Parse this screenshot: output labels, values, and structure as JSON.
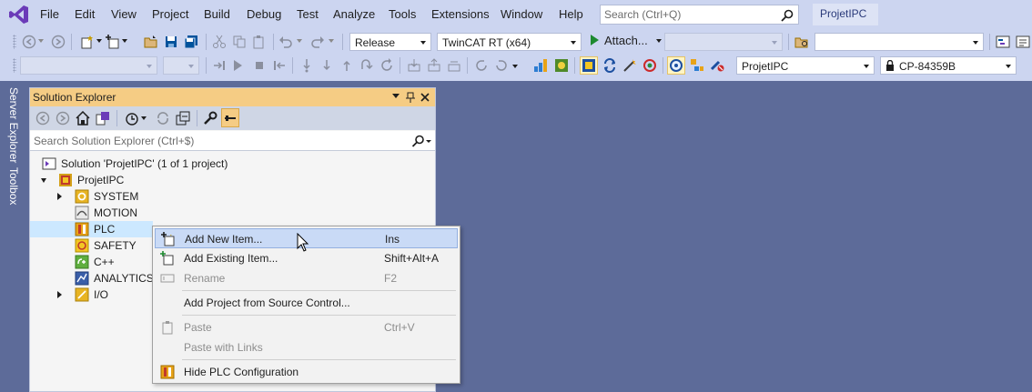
{
  "menu": [
    "File",
    "Edit",
    "View",
    "Project",
    "Build",
    "Debug",
    "Test",
    "Analyze",
    "Tools",
    "Extensions",
    "Window",
    "Help"
  ],
  "search": {
    "placeholder": "Search (Ctrl+Q)"
  },
  "project_title": "ProjetIPC",
  "toolbar1": {
    "configuration": "Release",
    "platform": "TwinCAT RT (x64)",
    "attach": "Attach...",
    "empty_combo_1": "",
    "empty_combo_2": ""
  },
  "toolbar2": {
    "project_combo": "ProjetIPC",
    "target_combo": "CP-84359B"
  },
  "side_tabs": [
    "Server Explorer",
    "Toolbox"
  ],
  "solution_explorer": {
    "title": "Solution Explorer",
    "search_placeholder": "Search Solution Explorer (Ctrl+$)",
    "solution_label": "Solution 'ProjetIPC' (1 of 1 project)",
    "project_label": "ProjetIPC",
    "nodes": [
      "SYSTEM",
      "MOTION",
      "PLC",
      "SAFETY",
      "C++",
      "ANALYTICS",
      "I/O"
    ]
  },
  "context_menu": {
    "items": [
      {
        "label": "Add New Item...",
        "shortcut": "Ins",
        "icon": "add-new-item-icon",
        "enabled": true
      },
      {
        "label": "Add Existing Item...",
        "shortcut": "Shift+Alt+A",
        "icon": "add-existing-item-icon",
        "enabled": true
      },
      {
        "label": "Rename",
        "shortcut": "F2",
        "icon": "rename-icon",
        "enabled": false
      },
      {
        "label": "Add Project from Source Control...",
        "shortcut": "",
        "icon": "",
        "enabled": true
      },
      {
        "label": "Paste",
        "shortcut": "Ctrl+V",
        "icon": "paste-icon",
        "enabled": false
      },
      {
        "label": "Paste with Links",
        "shortcut": "",
        "icon": "",
        "enabled": false
      },
      {
        "label": "Hide PLC Configuration",
        "shortcut": "",
        "icon": "plc-config-icon",
        "enabled": true
      }
    ]
  },
  "colors": {
    "background": "#5d6b99",
    "chrome": "#ccd5f0",
    "title_active": "#f5cc84",
    "menu_hover": "#c9daf6"
  }
}
